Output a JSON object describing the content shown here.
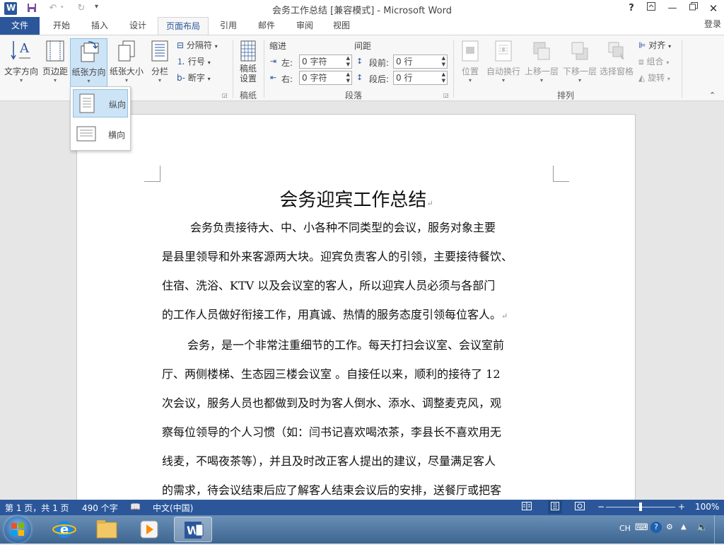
{
  "window": {
    "title": "会务工作总结 [兼容模式] - Microsoft Word",
    "help": "?",
    "signin": "登录"
  },
  "tabs": {
    "file": "文件",
    "home": "开始",
    "insert": "插入",
    "design": "设计",
    "layout": "页面布局",
    "references": "引用",
    "mailings": "邮件",
    "review": "审阅",
    "view": "视图"
  },
  "ribbon": {
    "text_direction": "文字方向",
    "margins": "页边距",
    "orientation": "纸张方向",
    "size": "纸张大小",
    "columns": "分栏",
    "breaks": "分隔符",
    "line_numbers": "行号",
    "hyphenation": "断字",
    "manuscript_setup_l1": "稿纸",
    "manuscript_setup_l2": "设置",
    "group_manuscript": "稿纸",
    "indent_header": "缩进",
    "spacing_header": "间距",
    "indent_left_label": "左:",
    "indent_left_value": "0 字符",
    "indent_right_label": "右:",
    "indent_right_value": "0 字符",
    "spacing_before_label": "段前:",
    "spacing_before_value": "0 行",
    "spacing_after_label": "段后:",
    "spacing_after_value": "0 行",
    "group_paragraph": "段落",
    "position": "位置",
    "wrap_text": "自动换行",
    "bring_forward": "上移一层",
    "send_backward": "下移一层",
    "selection_pane": "选择窗格",
    "align": "对齐",
    "group": "组合",
    "rotate": "旋转",
    "group_arrange": "排列"
  },
  "orientation_menu": {
    "portrait": "纵向",
    "landscape": "横向"
  },
  "document": {
    "title": "会务迎宾工作总结",
    "para1": [
      "会务负责接待大、中、小各种不同类型的会议，服务对象主要",
      "是县里领导和外来客源两大块。迎宾负责客人的引领，主要接待餐饮、",
      "住宿、洗浴、KTV 以及会议室的客人，所以迎宾人员必须与各部门",
      "的工作人员做好衔接工作，用真诚、热情的服务态度引领每位客人。"
    ],
    "para2": [
      "会务，是一个非常注重细节的工作。每天打扫会议室、会议室前",
      "厅、两侧楼梯、生态园三楼会议室 。自接任以来，顺利的接待了 12",
      "次会议，服务人员也都做到及时为客人倒水、添水、调整麦克风，观",
      "察每位领导的个人习惯（如：闫书记喜欢喝浓茶，李县长不喜欢用无",
      "线麦，不喝夜茶等），并且及时改正客人提出的建议，尽量满足客人",
      "的需求，待会议结束后应了解客人结束会议后的安排，送餐厅或把客"
    ]
  },
  "statusbar": {
    "page": "第 1 页，共 1 页",
    "words": "490 个字",
    "language": "中文(中国)",
    "zoom": "100%",
    "zoom_level": 0.5
  },
  "taskbar": {
    "ime": "CH"
  },
  "colors": {
    "accent": "#2b579a",
    "selection": "#cde4f7"
  }
}
